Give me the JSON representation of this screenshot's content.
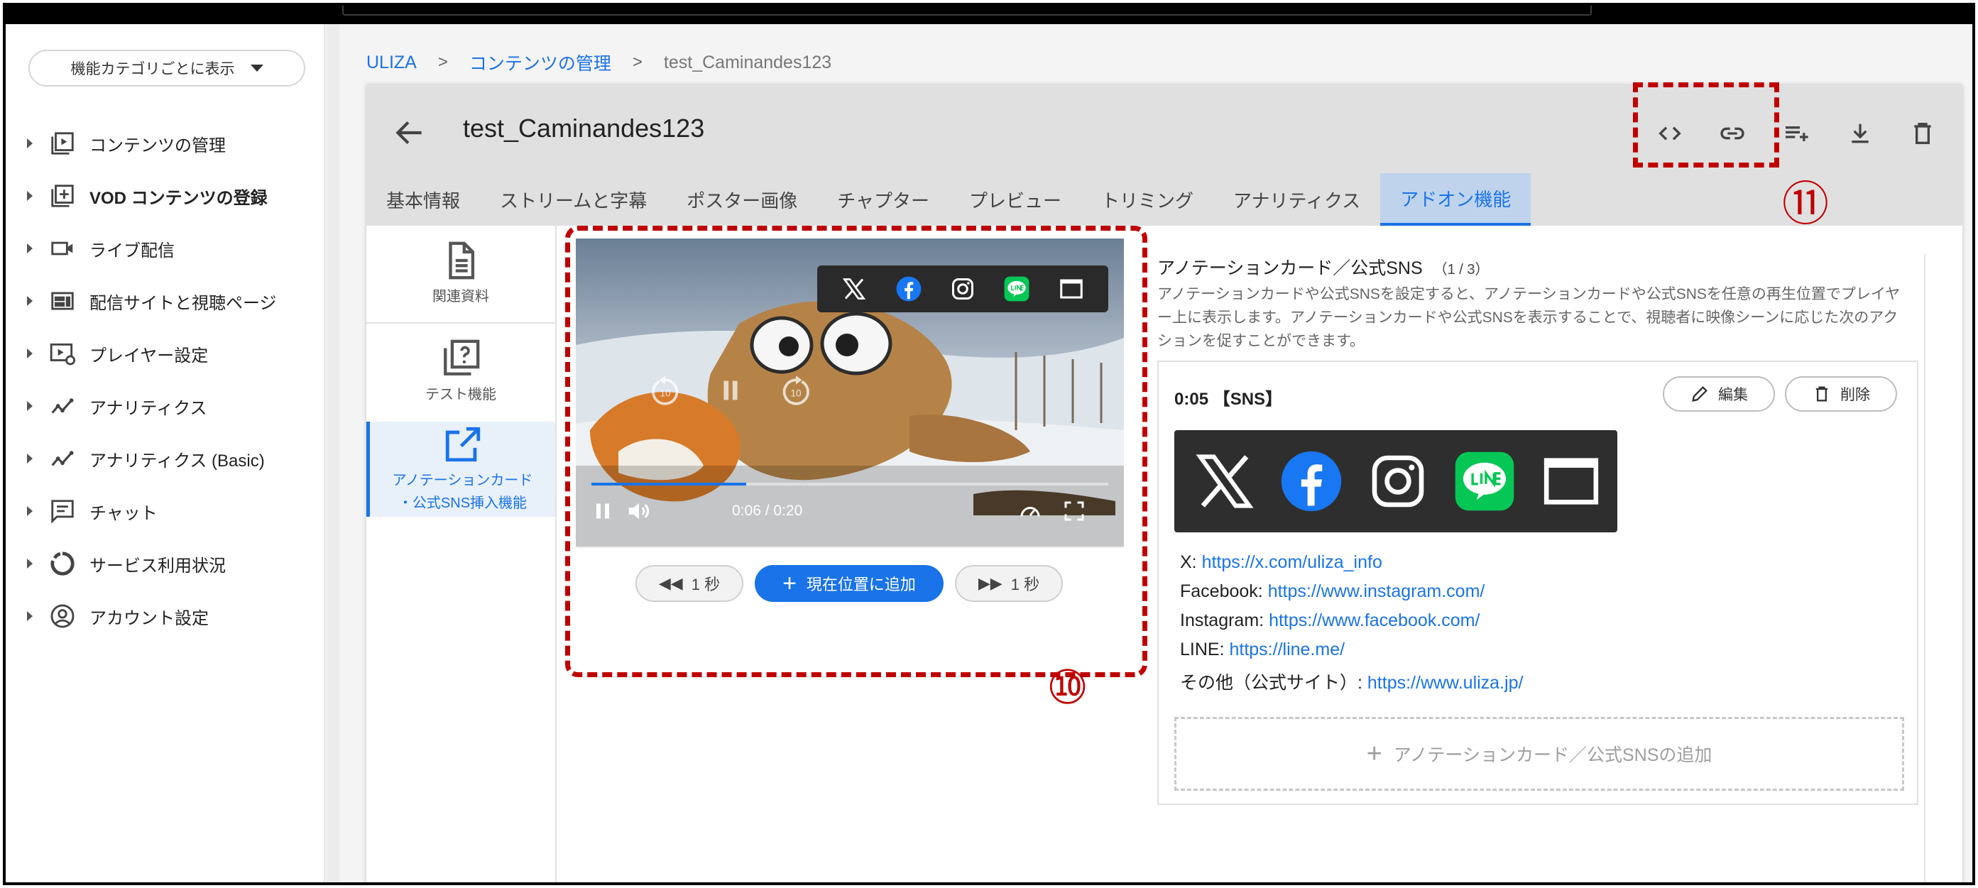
{
  "sidebar": {
    "category_select": "機能カテゴリごとに表示",
    "items": [
      {
        "label": "コンテンツの管理",
        "icon": "play-library-icon"
      },
      {
        "label": "VOD コンテンツの登録",
        "icon": "add-box-icon"
      },
      {
        "label": "ライブ配信",
        "icon": "videocam-icon"
      },
      {
        "label": "配信サイトと視聴ページ",
        "icon": "web-page-icon"
      },
      {
        "label": "プレイヤー設定",
        "icon": "player-settings-icon"
      },
      {
        "label": "アナリティクス",
        "icon": "analytics-icon"
      },
      {
        "label": "アナリティクス (Basic)",
        "icon": "analytics-icon"
      },
      {
        "label": "チャット",
        "icon": "chat-icon"
      },
      {
        "label": "サービス利用状況",
        "icon": "usage-donut-icon"
      },
      {
        "label": "アカウント設定",
        "icon": "account-icon"
      }
    ]
  },
  "breadcrumb": {
    "root": "ULIZA",
    "section": "コンテンツの管理",
    "current": "test_Caminandes123",
    "separator": ">"
  },
  "page": {
    "title": "test_Caminandes123",
    "header_icons": [
      "embed-code-icon",
      "link-icon",
      "playlist-add-icon",
      "download-icon",
      "delete-icon"
    ]
  },
  "tabs": [
    {
      "label": "基本情報",
      "active": false
    },
    {
      "label": "ストリームと字幕",
      "active": false
    },
    {
      "label": "ポスター画像",
      "active": false
    },
    {
      "label": "チャプター",
      "active": false
    },
    {
      "label": "プレビュー",
      "active": false
    },
    {
      "label": "トリミング",
      "active": false
    },
    {
      "label": "アナリティクス",
      "active": false
    },
    {
      "label": "アドオン機能",
      "active": true
    }
  ],
  "addon_menu": {
    "items": [
      {
        "label": "関連資料",
        "icon": "document-icon"
      },
      {
        "label": "テスト機能",
        "icon": "quiz-icon"
      },
      {
        "label_line1": "アノテーションカード",
        "label_line2": "・公式SNS挿入機能",
        "icon": "open-in-new-icon",
        "active": true
      }
    ]
  },
  "player": {
    "time_current": "0:06",
    "time_total": "0:20",
    "time_text": "0:06 / 0:20",
    "progress_fraction": 0.3,
    "overlay_sns": [
      "x-icon",
      "facebook-icon",
      "instagram-icon",
      "line-icon",
      "website-icon"
    ],
    "rewind_label": "1 秒",
    "add_label": "現在位置に追加",
    "forward_label": "1 秒",
    "skip_back_label": "10",
    "skip_fwd_label": "10"
  },
  "annotation": {
    "title": "アノテーションカード／公式SNS",
    "count": "（1 / 3）",
    "description": "アノテーションカードや公式SNSを設定すると、アノテーションカードや公式SNSを任意の再生位置でプレイヤー上に表示します。アノテーションカードや公式SNSを表示することで、視聴者に映像シーンに応じた次のアクションを促すことができます。",
    "card": {
      "time_tag": "0:05 【SNS】",
      "edit_label": "編集",
      "delete_label": "削除",
      "links": [
        {
          "label": "X: ",
          "url": "https://x.com/uliza_info"
        },
        {
          "label": "Facebook: ",
          "url": "https://www.instagram.com/"
        },
        {
          "label": "Instagram: ",
          "url": "https://www.facebook.com/"
        },
        {
          "label": "LINE: ",
          "url": "https://line.me/"
        },
        {
          "label": "その他（公式サイト）: ",
          "url": "https://www.uliza.jp/"
        }
      ]
    },
    "add_label": "アノテーションカード／公式SNSの追加"
  },
  "callouts": {
    "ten": "⑩",
    "eleven": "⑪"
  },
  "colors": {
    "accent": "#1a73e8",
    "callout_red": "#c00000",
    "header_bg": "#e0e0e0",
    "line_green": "#06c755",
    "facebook_blue": "#1877f2"
  }
}
